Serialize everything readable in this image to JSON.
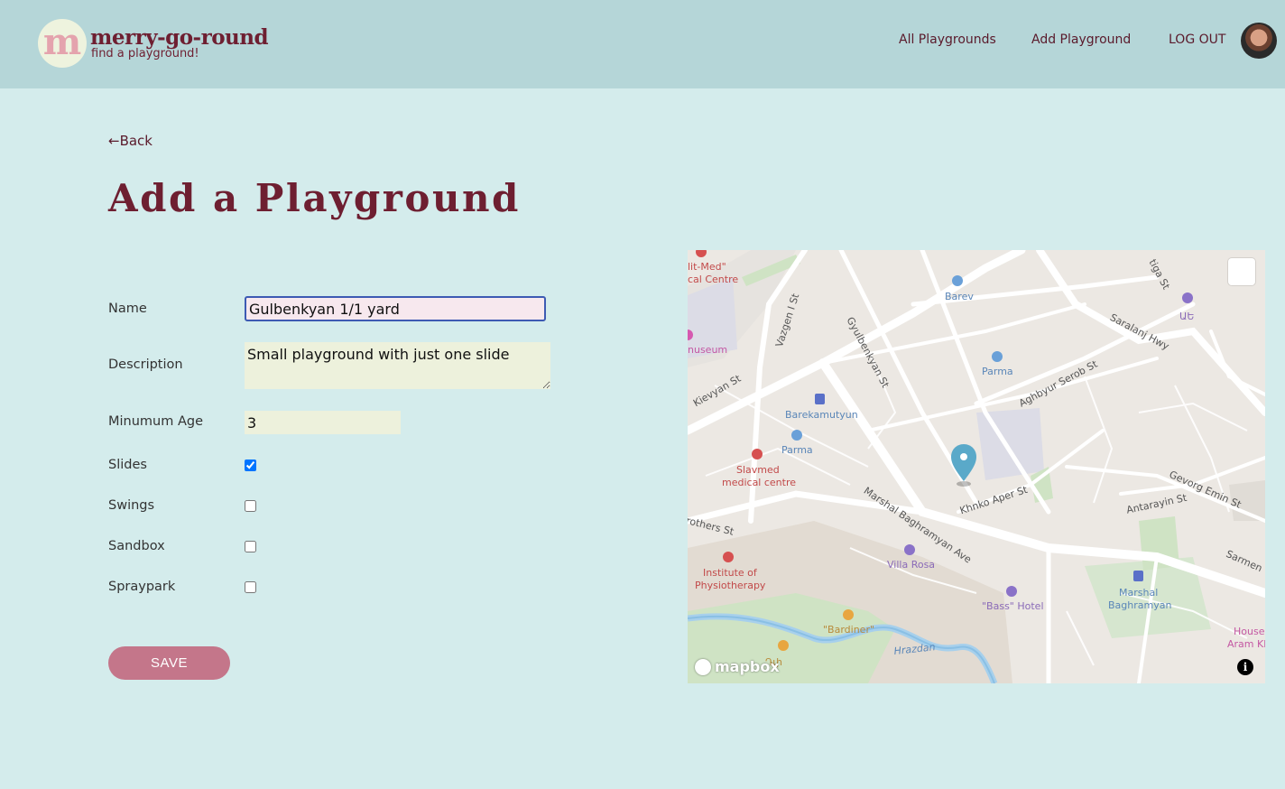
{
  "header": {
    "logo_letter": "m",
    "brand_name": "merry-go-round",
    "tagline": "find a playground!",
    "nav": [
      "All Playgrounds",
      "Add Playground",
      "LOG OUT"
    ]
  },
  "back_label": "←Back",
  "page_title": "Add a Playground",
  "form": {
    "name_label": "Name",
    "name_value": "Gulbenkyan 1/1 yard",
    "description_label": "Description",
    "description_value": "Small playground with just one slide",
    "min_age_label": "Minumum Age",
    "min_age_value": "3",
    "features": [
      {
        "label": "Slides",
        "checked": true
      },
      {
        "label": "Swings",
        "checked": false
      },
      {
        "label": "Sandbox",
        "checked": false
      },
      {
        "label": "Spraypark",
        "checked": false
      }
    ],
    "save_label": "SAVE"
  },
  "map": {
    "streets": [
      "Kievyan St",
      "Vazgen I St",
      "Gyulbenkyan St",
      "Saralanj Hwy",
      "Aghbyur Serob St",
      "Marshal Baghramyan Ave",
      "Khnko Aper St",
      "Antarayin St",
      "Gevorg Emin St",
      "rothers St",
      "Sarmen",
      "tiga St",
      "Hrazdan"
    ],
    "pois": [
      "Barev",
      "Parma",
      "Barekamutyun",
      "Parma",
      "Slavmed",
      "medical centre",
      "lit-Med\"",
      "cal Centre",
      "nuseum",
      "Institute of",
      "Physiotherapy",
      "Villa Rosa",
      "\"Bass\" Hotel",
      "Marshal",
      "Baghramyan",
      "\"Bardiner\"",
      "Դփ",
      "ԱԵ",
      "House",
      "Aram Kl"
    ],
    "attribution": "mapbox",
    "info_symbol": "i"
  },
  "colors": {
    "background": "#d4ecec",
    "header": "#b5d6d8",
    "brand": "#6e1f31",
    "save_button": "#c4768a",
    "name_input_bg": "#f7e8ee",
    "input_bg": "#edf1dc",
    "map_pin": "#5aa9c9"
  }
}
